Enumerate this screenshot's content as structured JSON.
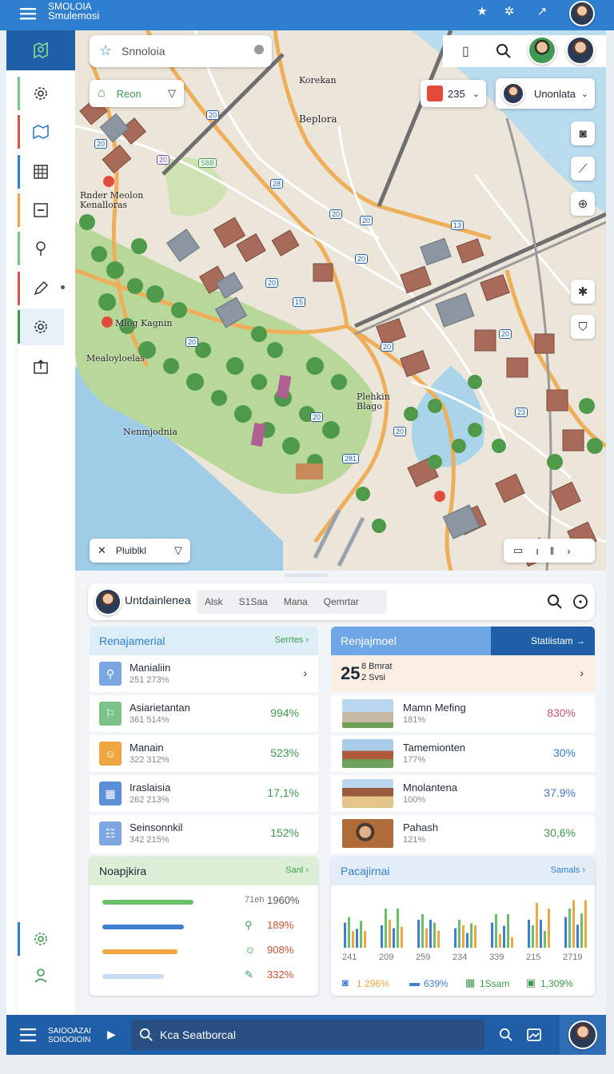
{
  "app": {
    "title_line1": "SMOLOIA",
    "title_line2": "Smulemosi"
  },
  "search": {
    "placeholder": "Snnoloia"
  },
  "map": {
    "filter_chip": "Reon",
    "count_chip": "235",
    "user_chip": "Unonlata",
    "bottom_chip": "Pluiblkl",
    "labels": [
      {
        "text": "Korekan"
      },
      {
        "text": "Beplora"
      },
      {
        "text": "Rnder Meolon"
      },
      {
        "text": "Kenalloras"
      },
      {
        "text": "Mlog Kagnin"
      },
      {
        "text": "Mealoyloelas"
      },
      {
        "text": "Nenmjodnia"
      },
      {
        "text": "Plehkin"
      },
      {
        "text": "Blago"
      }
    ],
    "badges": [
      "20",
      "20",
      "20",
      "S8B",
      "28",
      "20",
      "13",
      "20",
      "20",
      "15",
      "20",
      "20",
      "20",
      "20",
      "20",
      "281",
      "23",
      "20"
    ]
  },
  "control_bar": {
    "name": "Untdainlenea",
    "tabs": [
      "Alsk",
      "S1Saa",
      "Mana",
      "Qemrtar"
    ]
  },
  "card_left_top": {
    "title": "Renajamerial",
    "link": "Serrtes",
    "rows": [
      {
        "name": "Manialiin",
        "sub": "251 273%",
        "value": "",
        "icon": "person-icon",
        "color": "#7aa7e0"
      },
      {
        "name": "Asiarietantan",
        "sub": "361 514%",
        "value": "994%",
        "icon": "pedestrian-icon",
        "color": "#7cc38a"
      },
      {
        "name": "Manain",
        "sub": "322 312%",
        "value": "523%",
        "icon": "user-badge-icon",
        "color": "#f0a640"
      },
      {
        "name": "Iraslaisia",
        "sub": "262 213%",
        "value": "17,1%",
        "icon": "building-icon",
        "color": "#5b8fd6"
      },
      {
        "name": "Seinsonnkil",
        "sub": "342 215%",
        "value": "152%",
        "icon": "grid-icon",
        "color": "#7fa6e0"
      }
    ]
  },
  "card_right_top": {
    "title": "Renjajmoel",
    "link": "Statiistam",
    "highlight_value": "25",
    "highlight_line1": "8 Bmrat",
    "highlight_line2": "2 Svsi",
    "rows": [
      {
        "name": "Mamn Mefing",
        "sub": "181%",
        "value": "830%",
        "value_color": "#c2567a"
      },
      {
        "name": "Tamemionten",
        "sub": "177%",
        "value": "30%",
        "value_color": "#3a78c8"
      },
      {
        "name": "Mnolantena",
        "sub": "100%",
        "value": "37.9%",
        "value_color": "#3a78c8"
      },
      {
        "name": "Pahash",
        "sub": "121%",
        "value": "30,6%",
        "value_color": "#3e9a4f"
      }
    ]
  },
  "card_left_bottom": {
    "title": "Noapjkira",
    "link": "Sanl",
    "bars": [
      {
        "label": "71eh",
        "value": "1960%",
        "fill": 0.95,
        "color": "#6cbf69",
        "label_color": "#555"
      },
      {
        "label": "",
        "value": "189%",
        "fill": 0.85,
        "color": "#3f7fd0",
        "label_color": "#d0502d",
        "icon": "search-icon"
      },
      {
        "label": "",
        "value": "908%",
        "fill": 0.78,
        "color": "#f0a640",
        "label_color": "#d0502d",
        "icon": "person-icon"
      },
      {
        "label": "",
        "value": "332%",
        "fill": 0.64,
        "color": "#c8dcf2",
        "label_color": "#d0502d",
        "icon": "edit-icon"
      }
    ]
  },
  "card_right_bottom": {
    "title": "Pacajirnai",
    "link": "Samals",
    "chart_data": {
      "type": "bar",
      "categories": [
        "241",
        "209",
        "259",
        "234",
        "339",
        "215",
        "2719"
      ],
      "series": [
        {
          "values": [
            0.45,
            0.4,
            0.5,
            0.35,
            0.45,
            0.5,
            0.55
          ],
          "color": "#3f7fd0"
        },
        {
          "values": [
            0.55,
            0.7,
            0.6,
            0.5,
            0.6,
            0.4,
            0.7
          ],
          "color": "#6cbf69"
        },
        {
          "values": [
            0.3,
            0.5,
            0.35,
            0.4,
            0.25,
            0.8,
            0.85
          ],
          "color": "#f0a640"
        }
      ],
      "ylim": [
        0,
        1
      ]
    },
    "legend": [
      {
        "icon": "camera-icon",
        "value": "1 296%",
        "color": "#f0a640"
      },
      {
        "icon": "card-icon",
        "value": "639%",
        "color": "#3f7fd0"
      },
      {
        "icon": "ticket-icon",
        "value": "1Ssam",
        "color": "#3e9a4f"
      },
      {
        "icon": "image-icon",
        "value": "1,309%",
        "color": "#3e9a4f"
      }
    ]
  },
  "bottombar": {
    "title_line1": "SAIOOAZAI",
    "title_line2": "SOIOOIOIN",
    "search_text": "Kca Seatborcal"
  }
}
